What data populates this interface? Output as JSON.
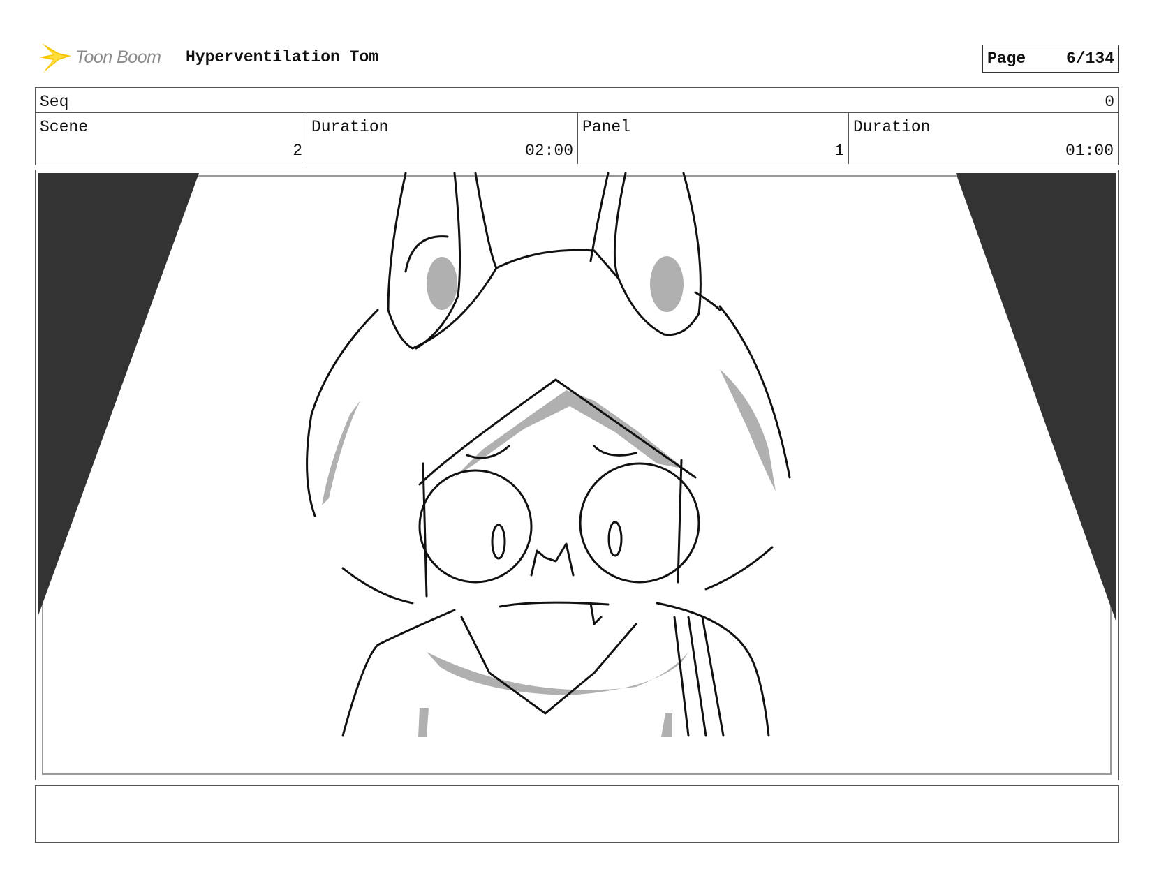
{
  "header": {
    "logo_text": "Toon Boom",
    "project_title": "Hyperventilation Tom",
    "page_label": "Page",
    "page_value": "6/134"
  },
  "info": {
    "seq_label": "Seq",
    "seq_value": "0",
    "scene_label": "Scene",
    "scene_value": "2",
    "scene_duration_label": "Duration",
    "scene_duration_value": "02:00",
    "panel_label": "Panel",
    "panel_value": "1",
    "panel_duration_label": "Duration",
    "panel_duration_value": "01:00"
  },
  "panel": {
    "drawing": "rabbit-eared-character-sketch",
    "shade_color": "#b0b0b0",
    "curtain_color": "#333333"
  },
  "notes": {
    "text": ""
  }
}
